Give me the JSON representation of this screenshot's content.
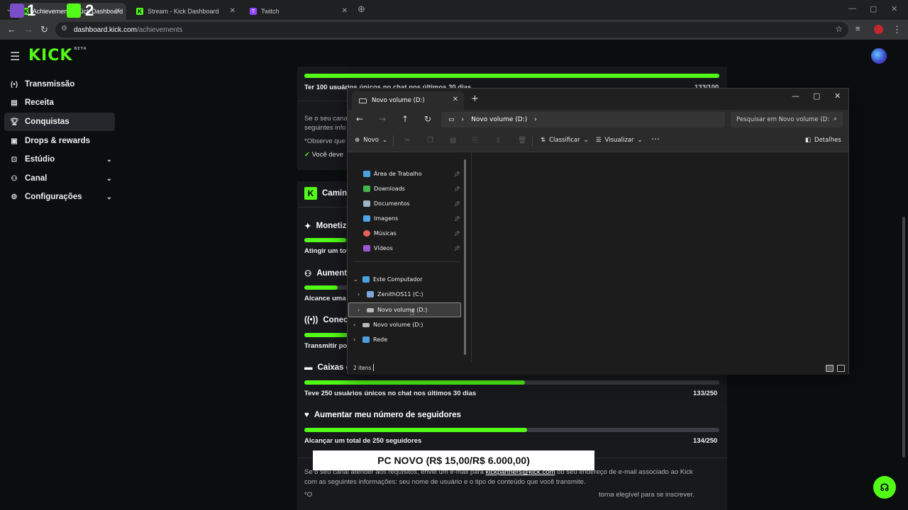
{
  "browser": {
    "tabs": [
      {
        "label": "Achievements | Kick Dashboard"
      },
      {
        "label": "Stream - Kick Dashboard"
      },
      {
        "label": "Twitch"
      }
    ],
    "overlay_digits": [
      "1",
      "2"
    ],
    "url_host": "dashboard.kick.com",
    "url_path": "/achievements"
  },
  "sidebar": {
    "logo": "KICK",
    "logo_tag": "BETA",
    "items": [
      {
        "label": "Transmissão",
        "icon": "broadcast-icon"
      },
      {
        "label": "Receita",
        "icon": "revenue-icon"
      },
      {
        "label": "Conquistas",
        "icon": "trophy-icon",
        "selected": true
      },
      {
        "label": "Drops & rewards",
        "icon": "gift-icon"
      },
      {
        "label": "Estúdio",
        "icon": "studio-icon",
        "expandable": true
      },
      {
        "label": "Canal",
        "icon": "channel-icon",
        "expandable": true
      },
      {
        "label": "Configurações",
        "icon": "gear-icon",
        "expandable": true
      }
    ]
  },
  "main": {
    "top_progress": {
      "label": "Ter 100 usuários únicos no chat nos últimos 30 dias",
      "count": "133/100",
      "fraction": 1.0
    },
    "top_note_1": "Se o seu canal",
    "top_note_2": "seguintes info",
    "top_note_3": "*Observe que",
    "top_check": "Você deve",
    "path_title": "Camin",
    "sections": [
      {
        "title": "Monetiz",
        "icon": "sparkle-icon",
        "label": "Atingir um tot",
        "fraction": 0.1
      },
      {
        "title": "Aumenta",
        "icon": "users-icon",
        "label": "Alcance uma",
        "fraction": 0.08
      },
      {
        "title": "Conecta",
        "icon": "signal-icon",
        "label": "Transmitir po",
        "fraction": 0.2
      },
      {
        "title": "Caixas d",
        "icon": "chat-icon",
        "label": "Teve 250 usuários únicos no chat nos últimos 30 dias",
        "count": "133/250",
        "fraction": 0.532
      },
      {
        "title": "Aumentar meu número de seguidores",
        "icon": "heart-icon",
        "label": "Alcançar um total de 250 seguidores",
        "count": "134/250",
        "fraction": 0.536
      }
    ],
    "footer_1_pre": "Se o seu canal atender aos requisitos, envie um e-mail para ",
    "footer_1_link": "kickpartners@kick.com",
    "footer_1_post": " do seu endereço de e-mail associado ao Kick",
    "footer_2": "com as seguintes informações: seu nome de usuário e o tipo de conteúdo que você transmite.",
    "footer_3_pre": "*O",
    "footer_3_post": "torna elegível para se inscrever."
  },
  "overlay_banner": "PC NOVO (R$ 15,00/R$ 6.000,00)",
  "explorer": {
    "tab_title": "Novo volume (D:)",
    "breadcrumb": "Novo volume (D:)",
    "search_placeholder": "Pesquisar em Novo volume (D:",
    "toolbar": {
      "new": "Novo",
      "sort": "Classificar",
      "view": "Visualizar",
      "details": "Detalhes"
    },
    "quick_access": [
      {
        "label": "Área de Trabalho",
        "color": "#4aa3e0"
      },
      {
        "label": "Downloads",
        "color": "#3fb54a"
      },
      {
        "label": "Documentos",
        "color": "#9fb3c8"
      },
      {
        "label": "Imagens",
        "color": "#4fa6e8"
      },
      {
        "label": "Músicas",
        "color": "#e8615a"
      },
      {
        "label": "Vídeos",
        "color": "#9b59d6"
      }
    ],
    "tree": {
      "this_pc": "Este Computador",
      "drive_c": "ZenithOS11 (C:)",
      "drive_d_sub": "Novo volume (D:)",
      "drive_d": "Novo volume (D:)",
      "network": "Rede"
    },
    "status": "2 itens"
  },
  "colors": {
    "kick_green": "#53fc18",
    "bg": "#0b0e0f",
    "card": "#18191d"
  }
}
